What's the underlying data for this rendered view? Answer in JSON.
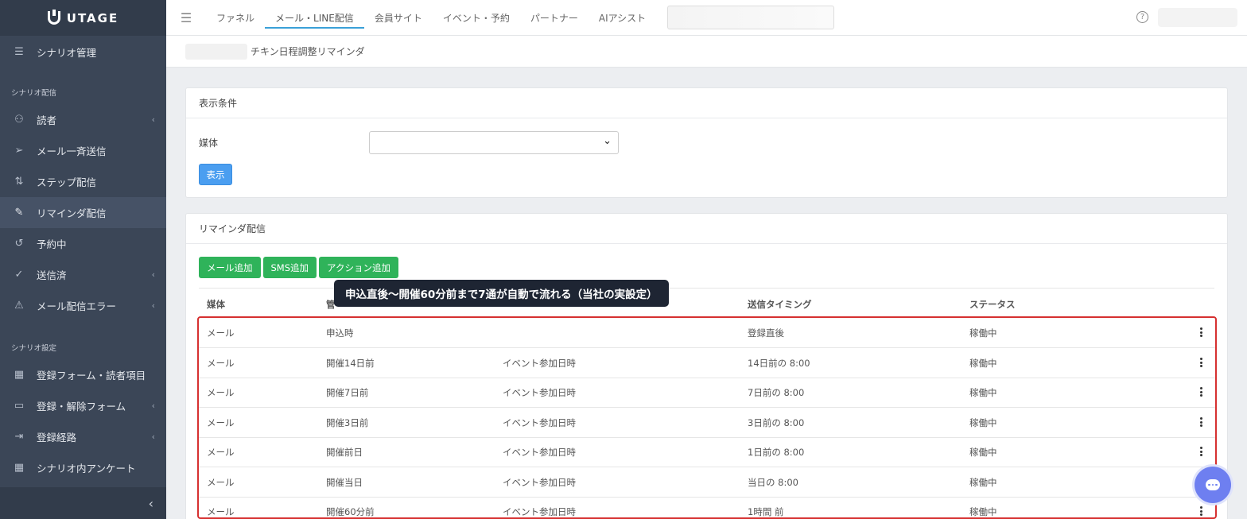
{
  "brand": {
    "name": "UTAGE"
  },
  "sidebar": {
    "items": [
      {
        "label": "シナリオ管理",
        "icon": "list-icon",
        "chevron": false
      },
      {
        "label": "読者",
        "icon": "users-icon",
        "chevron": true
      },
      {
        "label": "メール一斉送信",
        "icon": "send-icon",
        "chevron": false
      },
      {
        "label": "ステップ配信",
        "icon": "sort-icon",
        "chevron": false
      },
      {
        "label": "リマインダ配信",
        "icon": "pencil-icon",
        "chevron": false,
        "active": true
      },
      {
        "label": "予約中",
        "icon": "history-icon",
        "chevron": false
      },
      {
        "label": "送信済",
        "icon": "check-icon",
        "chevron": true
      },
      {
        "label": "メール配信エラー",
        "icon": "warning-icon",
        "chevron": true
      },
      {
        "label": "登録フォーム・読者項目",
        "icon": "table-icon",
        "chevron": false
      },
      {
        "label": "登録・解除フォーム",
        "icon": "form-icon",
        "chevron": true
      },
      {
        "label": "登録経路",
        "icon": "sign-in-icon",
        "chevron": true
      },
      {
        "label": "シナリオ内アンケート",
        "icon": "table-icon",
        "chevron": false
      }
    ],
    "section_delivery": "シナリオ配信",
    "section_settings": "シナリオ設定",
    "collapse_glyph": "‹"
  },
  "topnav": {
    "tabs": [
      "ファネル",
      "メール・LINE配信",
      "会員サイト",
      "イベント・予約",
      "パートナー",
      "AIアシスト"
    ],
    "active_index": 1,
    "help_glyph": "?"
  },
  "breadcrumb": {
    "current": "チキン日程調整リマインダ"
  },
  "filter_card": {
    "title": "表示条件",
    "media_label": "媒体",
    "show_button": "表示"
  },
  "reminder_card": {
    "title": "リマインダ配信",
    "buttons": [
      "メール追加",
      "SMS追加",
      "アクション追加"
    ],
    "headers": {
      "media": "媒体",
      "manage": "管",
      "timing": "送信タイミング",
      "status": "ステータス"
    },
    "rows": [
      {
        "media": "メール",
        "name": "申込時",
        "base": "",
        "timing": "登録直後",
        "status": "稼働中"
      },
      {
        "media": "メール",
        "name": "開催14日前",
        "base": "イベント参加日時",
        "timing": "14日前の 8:00",
        "status": "稼働中"
      },
      {
        "media": "メール",
        "name": "開催7日前",
        "base": "イベント参加日時",
        "timing": "7日前の 8:00",
        "status": "稼働中"
      },
      {
        "media": "メール",
        "name": "開催3日前",
        "base": "イベント参加日時",
        "timing": "3日前の 8:00",
        "status": "稼働中"
      },
      {
        "media": "メール",
        "name": "開催前日",
        "base": "イベント参加日時",
        "timing": "1日前の 8:00",
        "status": "稼働中"
      },
      {
        "media": "メール",
        "name": "開催当日",
        "base": "イベント参加日時",
        "timing": "当日の 8:00",
        "status": "稼働中"
      },
      {
        "media": "メール",
        "name": "開催60分前",
        "base": "イベント参加日時",
        "timing": "1時間 前",
        "status": "稼働中"
      }
    ]
  },
  "tooltip": {
    "text": "申込直後〜開催60分前まで7通が自動で流れる（当社の実設定）"
  },
  "colors": {
    "sidebar": "#3b4657",
    "accent_green": "#2fb35a",
    "accent_blue": "#4b9ef0",
    "highlight_red": "#d63030",
    "chat": "#6e7ff0"
  }
}
